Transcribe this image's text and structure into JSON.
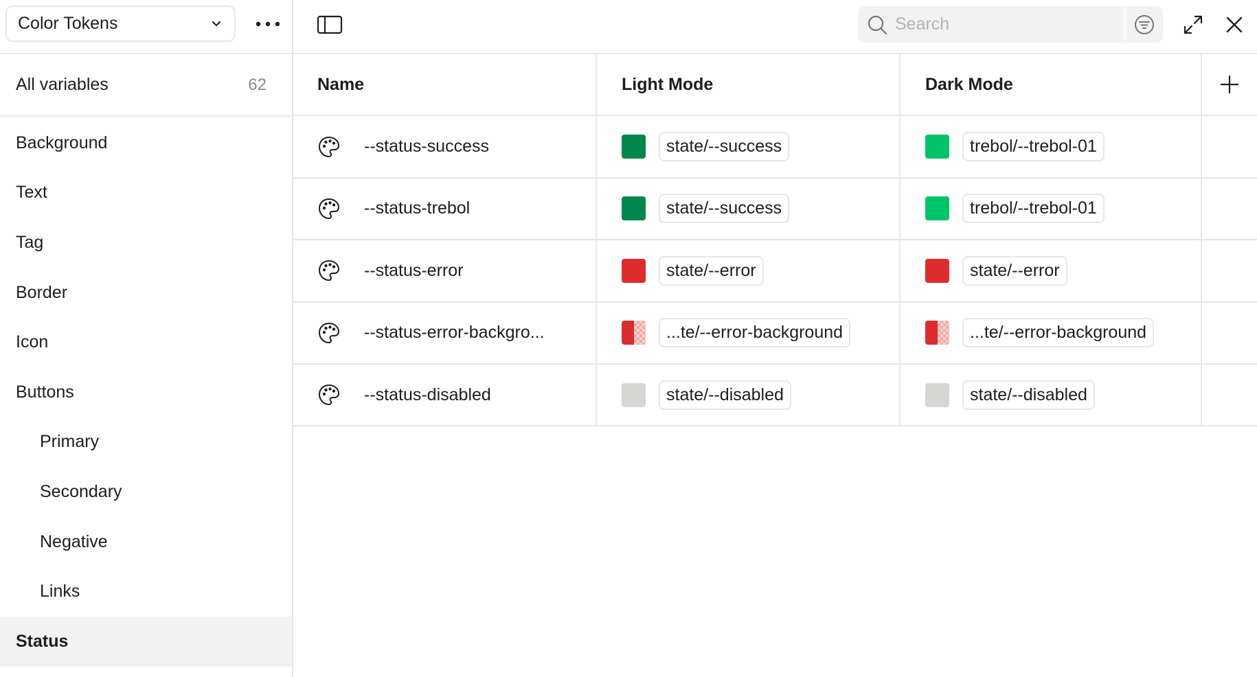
{
  "sidebar": {
    "collection": "Color Tokens",
    "all_variables_label": "All variables",
    "all_variables_count": "62",
    "groups": [
      {
        "label": "Background"
      },
      {
        "label": "Text"
      },
      {
        "label": "Tag"
      },
      {
        "label": "Border"
      },
      {
        "label": "Icon"
      },
      {
        "label": "Buttons"
      },
      {
        "label": "Primary"
      },
      {
        "label": "Secondary"
      },
      {
        "label": "Negative"
      },
      {
        "label": "Links"
      },
      {
        "label": "Status"
      }
    ],
    "active_group": "Status"
  },
  "toolbar": {
    "search_placeholder": "Search"
  },
  "table": {
    "columns": [
      "Name",
      "Light Mode",
      "Dark Mode"
    ],
    "rows": [
      {
        "name": "--status-success",
        "light_color": "#00884a",
        "light_value": "state/--success",
        "dark_color": "#00c46a",
        "dark_value": "trebol/--trebol-01"
      },
      {
        "name": "--status-trebol",
        "light_color": "#00884a",
        "light_value": "state/--success",
        "dark_color": "#00c46a",
        "dark_value": "trebol/--trebol-01"
      },
      {
        "name": "--status-error",
        "light_color": "#dd2c2c",
        "light_value": "state/--error",
        "dark_color": "#dd2c2c",
        "dark_value": "state/--error"
      },
      {
        "name": "--status-error-backgro...",
        "light_color": "#dd2c2c",
        "light_value": "...te/--error-background",
        "dark_color": "#dd2c2c",
        "dark_value": "...te/--error-background",
        "translucent": true
      },
      {
        "name": "--status-disabled",
        "light_color": "#d6d6d4",
        "light_value": "state/--disabled",
        "dark_color": "#d6d6d4",
        "dark_value": "state/--disabled"
      }
    ]
  },
  "icons": {
    "collection_chevron": "chevron-down-icon",
    "more": "more-horizontal-icon",
    "panel_toggle": "sidebar-panel-icon",
    "search": "search-icon",
    "filter": "filter-icon",
    "expand": "expand-icon",
    "close": "close-icon",
    "add_column": "plus-icon",
    "variable_type": "palette-icon"
  }
}
